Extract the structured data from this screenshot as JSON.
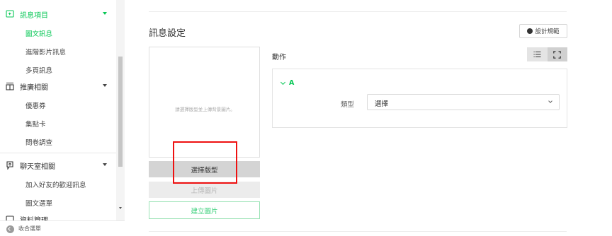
{
  "sidebar": {
    "sections": [
      {
        "label": "訊息項目",
        "icon": "message-plus-icon"
      },
      {
        "label": "推廣相關",
        "icon": "gift-icon"
      },
      {
        "label": "聊天室相關",
        "icon": "chat-icon"
      },
      {
        "label": "資料管理",
        "icon": "data-icon"
      }
    ],
    "items": {
      "rich_message": "圖文訊息",
      "rich_video": "進階影片訊息",
      "card_message": "多頁訊息",
      "coupon": "優惠券",
      "reward_card": "集點卡",
      "survey": "問卷調查",
      "greeting": "加入好友的歡迎訊息",
      "rich_menu": "圖文選單"
    },
    "collapse_label": "收合選單"
  },
  "main": {
    "title": "訊息設定",
    "guide_button": "設計規範",
    "preview_hint": "請選擇版型並上傳背景圖片。",
    "select_template_button": "選擇版型",
    "upload_image_button": "上傳圖片",
    "create_image_button": "建立圖片",
    "action_title": "動作",
    "view_toggle": {
      "list_icon": "list-view-icon",
      "full_icon": "expand-view-icon"
    },
    "action": {
      "label": "A",
      "type_label": "類型",
      "type_value": "選擇"
    }
  },
  "colors": {
    "accent": "#06c755",
    "highlight": "#ee1111"
  }
}
